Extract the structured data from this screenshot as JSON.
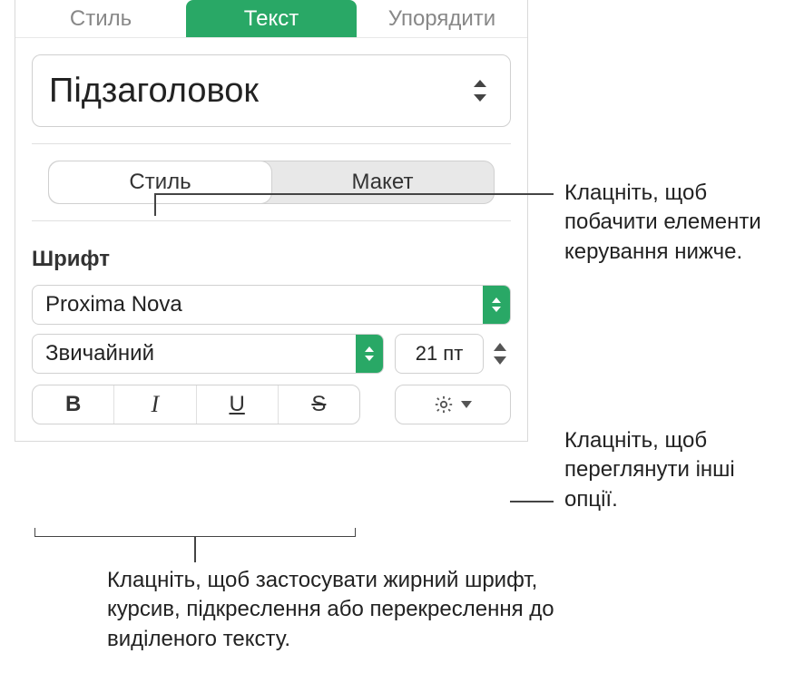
{
  "tabs": {
    "style": "Стиль",
    "text": "Текст",
    "arrange": "Упорядити"
  },
  "paragraphStyle": {
    "selected": "Підзаголовок"
  },
  "subTabs": {
    "style": "Стиль",
    "layout": "Макет"
  },
  "font": {
    "sectionLabel": "Шрифт",
    "family": "Proxima Nova",
    "typeface": "Звичайний",
    "size": "21 пт"
  },
  "styleButtons": {
    "bold": "B",
    "italic": "I",
    "underline": "U",
    "strike": "S"
  },
  "callouts": {
    "styleTab": "Клацніть, щоб побачити елементи керування нижче.",
    "gear": "Клацніть, щоб переглянути інші опції.",
    "styleGroup": "Клацніть, щоб застосувати жирний шрифт, курсив, підкреслення або перекреслення до виділеного тексту."
  }
}
